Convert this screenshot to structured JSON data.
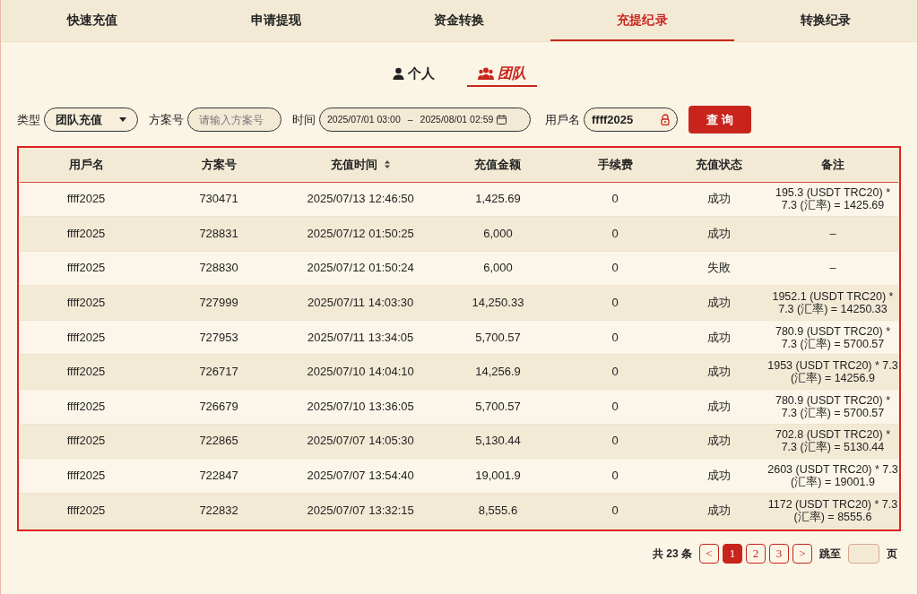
{
  "tabs": [
    {
      "label": "快速充值",
      "selected": false
    },
    {
      "label": "申请提现",
      "selected": false
    },
    {
      "label": "资金转换",
      "selected": false
    },
    {
      "label": "充提纪录",
      "selected": true
    },
    {
      "label": "转换纪录",
      "selected": false
    }
  ],
  "scope_tabs": [
    {
      "label": "个人",
      "kind": "person",
      "selected": false
    },
    {
      "label": "团队",
      "kind": "team",
      "selected": true
    }
  ],
  "filters": {
    "type_label": "类型",
    "type_value": "团队充值",
    "plan_label": "方案号",
    "plan_placeholder": "请输入方案号",
    "time_label": "时间",
    "time_start": "2025/07/01 03:00",
    "time_separator": "–",
    "time_end": "2025/08/01 02:59",
    "user_label": "用戶名",
    "user_value": "ffff2025",
    "query_button": "查 询"
  },
  "table": {
    "columns": [
      "用戶名",
      "方案号",
      "充值时间",
      "充值金额",
      "手续费",
      "充值状态",
      "备注"
    ],
    "rows": [
      [
        "ffff2025",
        "730471",
        "2025/07/13 12:46:50",
        "1,425.69",
        "0",
        "成功",
        "195.3 (USDT TRC20) * 7.3 (汇率) = 1425.69"
      ],
      [
        "ffff2025",
        "728831",
        "2025/07/12 01:50:25",
        "6,000",
        "0",
        "成功",
        "–"
      ],
      [
        "ffff2025",
        "728830",
        "2025/07/12 01:50:24",
        "6,000",
        "0",
        "失敗",
        "–"
      ],
      [
        "ffff2025",
        "727999",
        "2025/07/11 14:03:30",
        "14,250.33",
        "0",
        "成功",
        "1952.1 (USDT TRC20) * 7.3 (汇率) = 14250.33"
      ],
      [
        "ffff2025",
        "727953",
        "2025/07/11 13:34:05",
        "5,700.57",
        "0",
        "成功",
        "780.9 (USDT TRC20) * 7.3 (汇率) = 5700.57"
      ],
      [
        "ffff2025",
        "726717",
        "2025/07/10 14:04:10",
        "14,256.9",
        "0",
        "成功",
        "1953 (USDT TRC20) * 7.3 (汇率) = 14256.9"
      ],
      [
        "ffff2025",
        "726679",
        "2025/07/10 13:36:05",
        "5,700.57",
        "0",
        "成功",
        "780.9 (USDT TRC20) * 7.3 (汇率) = 5700.57"
      ],
      [
        "ffff2025",
        "722865",
        "2025/07/07 14:05:30",
        "5,130.44",
        "0",
        "成功",
        "702.8 (USDT TRC20) * 7.3 (汇率) = 5130.44"
      ],
      [
        "ffff2025",
        "722847",
        "2025/07/07 13:54:40",
        "19,001.9",
        "0",
        "成功",
        "2603 (USDT TRC20) * 7.3 (汇率) = 19001.9"
      ],
      [
        "ffff2025",
        "722832",
        "2025/07/07 13:32:15",
        "8,555.6",
        "0",
        "成功",
        "1172 (USDT TRC20) * 7.3 (汇率) = 8555.6"
      ]
    ]
  },
  "pagination": {
    "total": "共 23 条",
    "prev": "<",
    "pages": [
      {
        "label": "1",
        "selected": true
      },
      {
        "label": "2",
        "selected": false
      },
      {
        "label": "3",
        "selected": false
      }
    ],
    "next": ">",
    "goto_label": "跳至",
    "goto_suffix": "页"
  }
}
